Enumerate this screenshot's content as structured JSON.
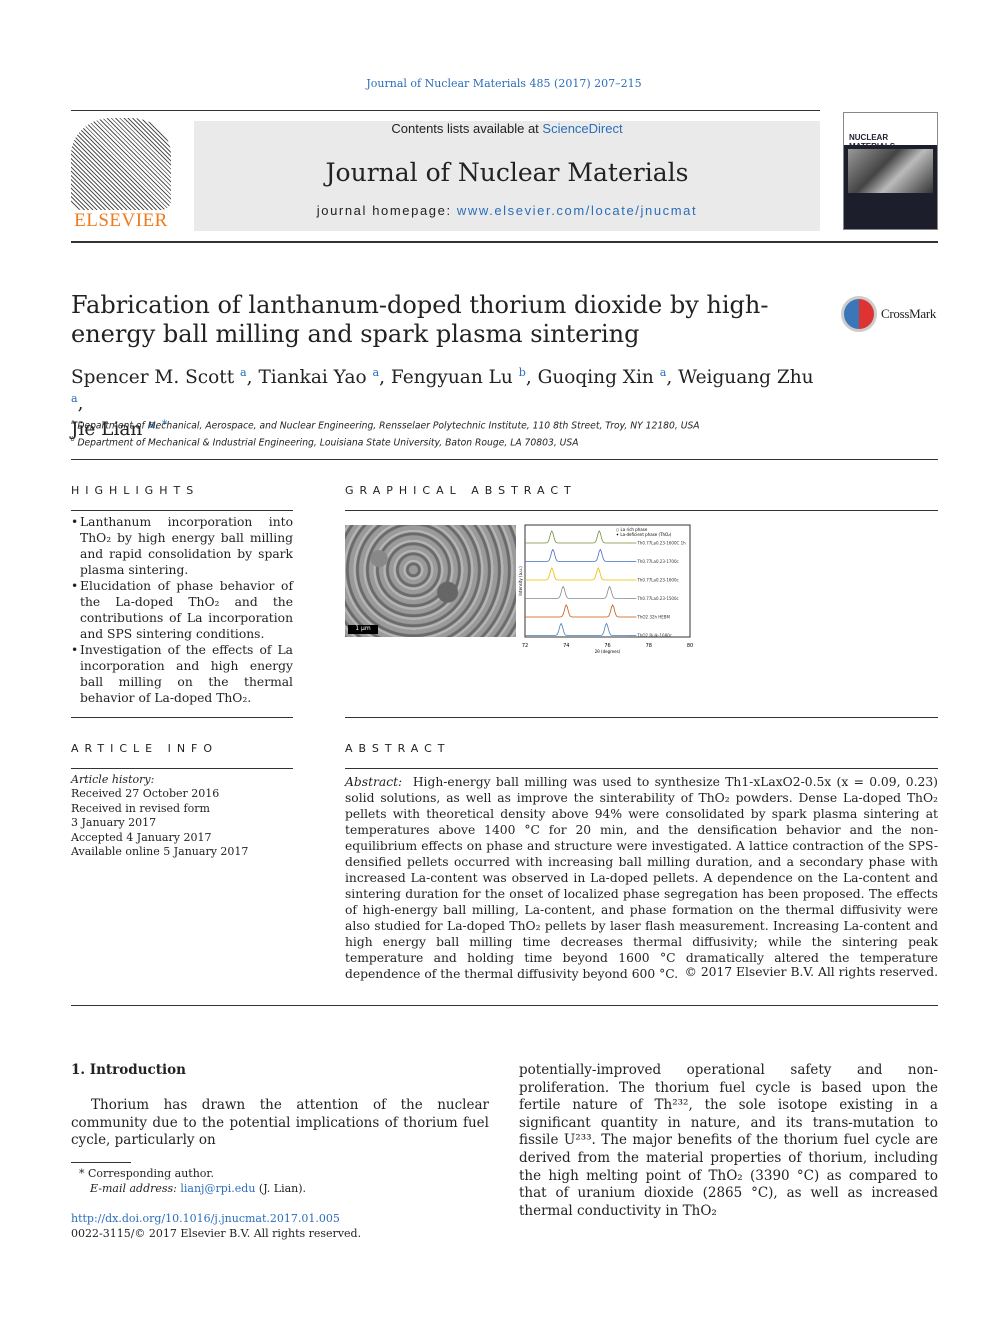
{
  "journal_ref": "Journal of Nuclear Materials 485 (2017) 207–215",
  "header": {
    "contents_prefix": "Contents lists available at ",
    "contents_link": "ScienceDirect",
    "journal_title": "Journal of Nuclear Materials",
    "homepage_prefix": "journal homepage: ",
    "homepage_url": "www.elsevier.com/locate/jnucmat",
    "publisher_logo": "ELSEVIER",
    "cover_title": "NUCLEAR MATERIALS"
  },
  "article": {
    "title": "Fabrication of lanthanum-doped thorium dioxide by high-energy ball milling and spark plasma sintering",
    "crossmark": "CrossMark",
    "authors": [
      {
        "name": "Spencer M. Scott",
        "aff": "a"
      },
      {
        "name": "Tiankai Yao",
        "aff": "a"
      },
      {
        "name": "Fengyuan Lu",
        "aff": "b"
      },
      {
        "name": "Guoqing Xin",
        "aff": "a"
      },
      {
        "name": "Weiguang Zhu",
        "aff": "a"
      },
      {
        "name": "Jie Lian",
        "aff": "a, *"
      }
    ],
    "affiliations": [
      {
        "key": "a",
        "text": "Department of Mechanical, Aerospace, and Nuclear Engineering, Rensselaer Polytechnic Institute, 110 8th Street, Troy, NY 12180, USA"
      },
      {
        "key": "b",
        "text": "Department of Mechanical & Industrial Engineering, Louisiana State University, Baton Rouge, LA 70803, USA"
      }
    ]
  },
  "highlights": {
    "heading": "HIGHLIGHTS",
    "items": [
      "Lanthanum incorporation into ThO₂ by high energy ball milling and rapid consolidation by spark plasma sintering.",
      "Elucidation of phase behavior of the La-doped ThO₂ and the contributions of La incorporation and SPS sintering conditions.",
      "Investigation of the effects of La incorporation and high energy ball milling on the thermal behavior of La-doped ThO₂."
    ]
  },
  "graphical_abstract": {
    "heading": "GRAPHICAL ABSTRACT",
    "scale_bar": "1 µm",
    "chart_data": {
      "type": "line",
      "xlabel": "2θ (degrees)",
      "ylabel": "Intensity (a.u.)",
      "xlim": [
        72,
        80
      ],
      "xticks": [
        "72",
        "74",
        "76",
        "78",
        "80"
      ],
      "legend": [
        "La rich phase",
        "La-deficient phase (ThO₂)"
      ],
      "series": [
        {
          "name": "Th0.77La0.23-1600C 1h",
          "color": "#77933c"
        },
        {
          "name": "Th0.77La0.23-1700c",
          "color": "#4472c4"
        },
        {
          "name": "Th0.77La0.23-1600c",
          "color": "#e6c000"
        },
        {
          "name": "Th0.77La0.23-1500c",
          "color": "#888888"
        },
        {
          "name": "ThO2 32h HEBM",
          "color": "#c55a11"
        },
        {
          "name": "ThO2 Bulk-1080c",
          "color": "#4a7ebb"
        }
      ]
    }
  },
  "article_info": {
    "heading": "ARTICLE INFO",
    "history_label": "Article history:",
    "lines": [
      "Received 27 October 2016",
      "Received in revised form",
      "3 January 2017",
      "Accepted 4 January 2017",
      "Available online 5 January 2017"
    ]
  },
  "abstract": {
    "heading": "ABSTRACT",
    "label": "Abstract:",
    "text": "High-energy ball milling was used to synthesize Th1-xLaxO2-0.5x (x = 0.09, 0.23) solid solutions, as well as improve the sinterability of ThO₂ powders. Dense La-doped ThO₂ pellets with theoretical density above 94% were consolidated by spark plasma sintering at temperatures above 1400 °C for 20 min, and the densification behavior and the non-equilibrium effects on phase and structure were investigated. A lattice contraction of the SPS-densified pellets occurred with increasing ball milling duration, and a secondary phase with increased La-content was observed in La-doped pellets. A dependence on the La-content and sintering duration for the onset of localized phase segregation has been proposed. The effects of high-energy ball milling, La-content, and phase formation on the thermal diffusivity were also studied for La-doped ThO₂ pellets by laser flash measurement. Increasing La-content and high energy ball milling time decreases thermal diffusivity; while the sintering peak temperature and holding time beyond 1600 °C dramatically altered the temperature dependence of the thermal diffusivity beyond 600 °C.",
    "copyright": "© 2017 Elsevier B.V. All rights reserved."
  },
  "intro": {
    "heading": "1.  Introduction",
    "col1": "Thorium has drawn the attention of the nuclear community due to the potential implications of thorium fuel cycle, particularly on",
    "col2": "potentially-improved operational safety and non-proliferation. The thorium fuel cycle is based upon the fertile nature of Th²³², the sole isotope existing in a significant quantity in nature, and its trans-mutation to fissile U²³³. The major benefits of the thorium fuel cycle are derived from the material properties of thorium, including the high melting point of ThO₂ (3390 °C) as compared to that of uranium dioxide (2865 °C), as well as increased thermal conductivity in ThO₂"
  },
  "footnote": {
    "corresponding": "* Corresponding author.",
    "email_label": "E-mail address: ",
    "email": "lianj@rpi.edu",
    "email_suffix": " (J. Lian).",
    "doi": "http://dx.doi.org/10.1016/j.jnucmat.2017.01.005",
    "issn": "0022-3115/© 2017 Elsevier B.V. All rights reserved."
  }
}
